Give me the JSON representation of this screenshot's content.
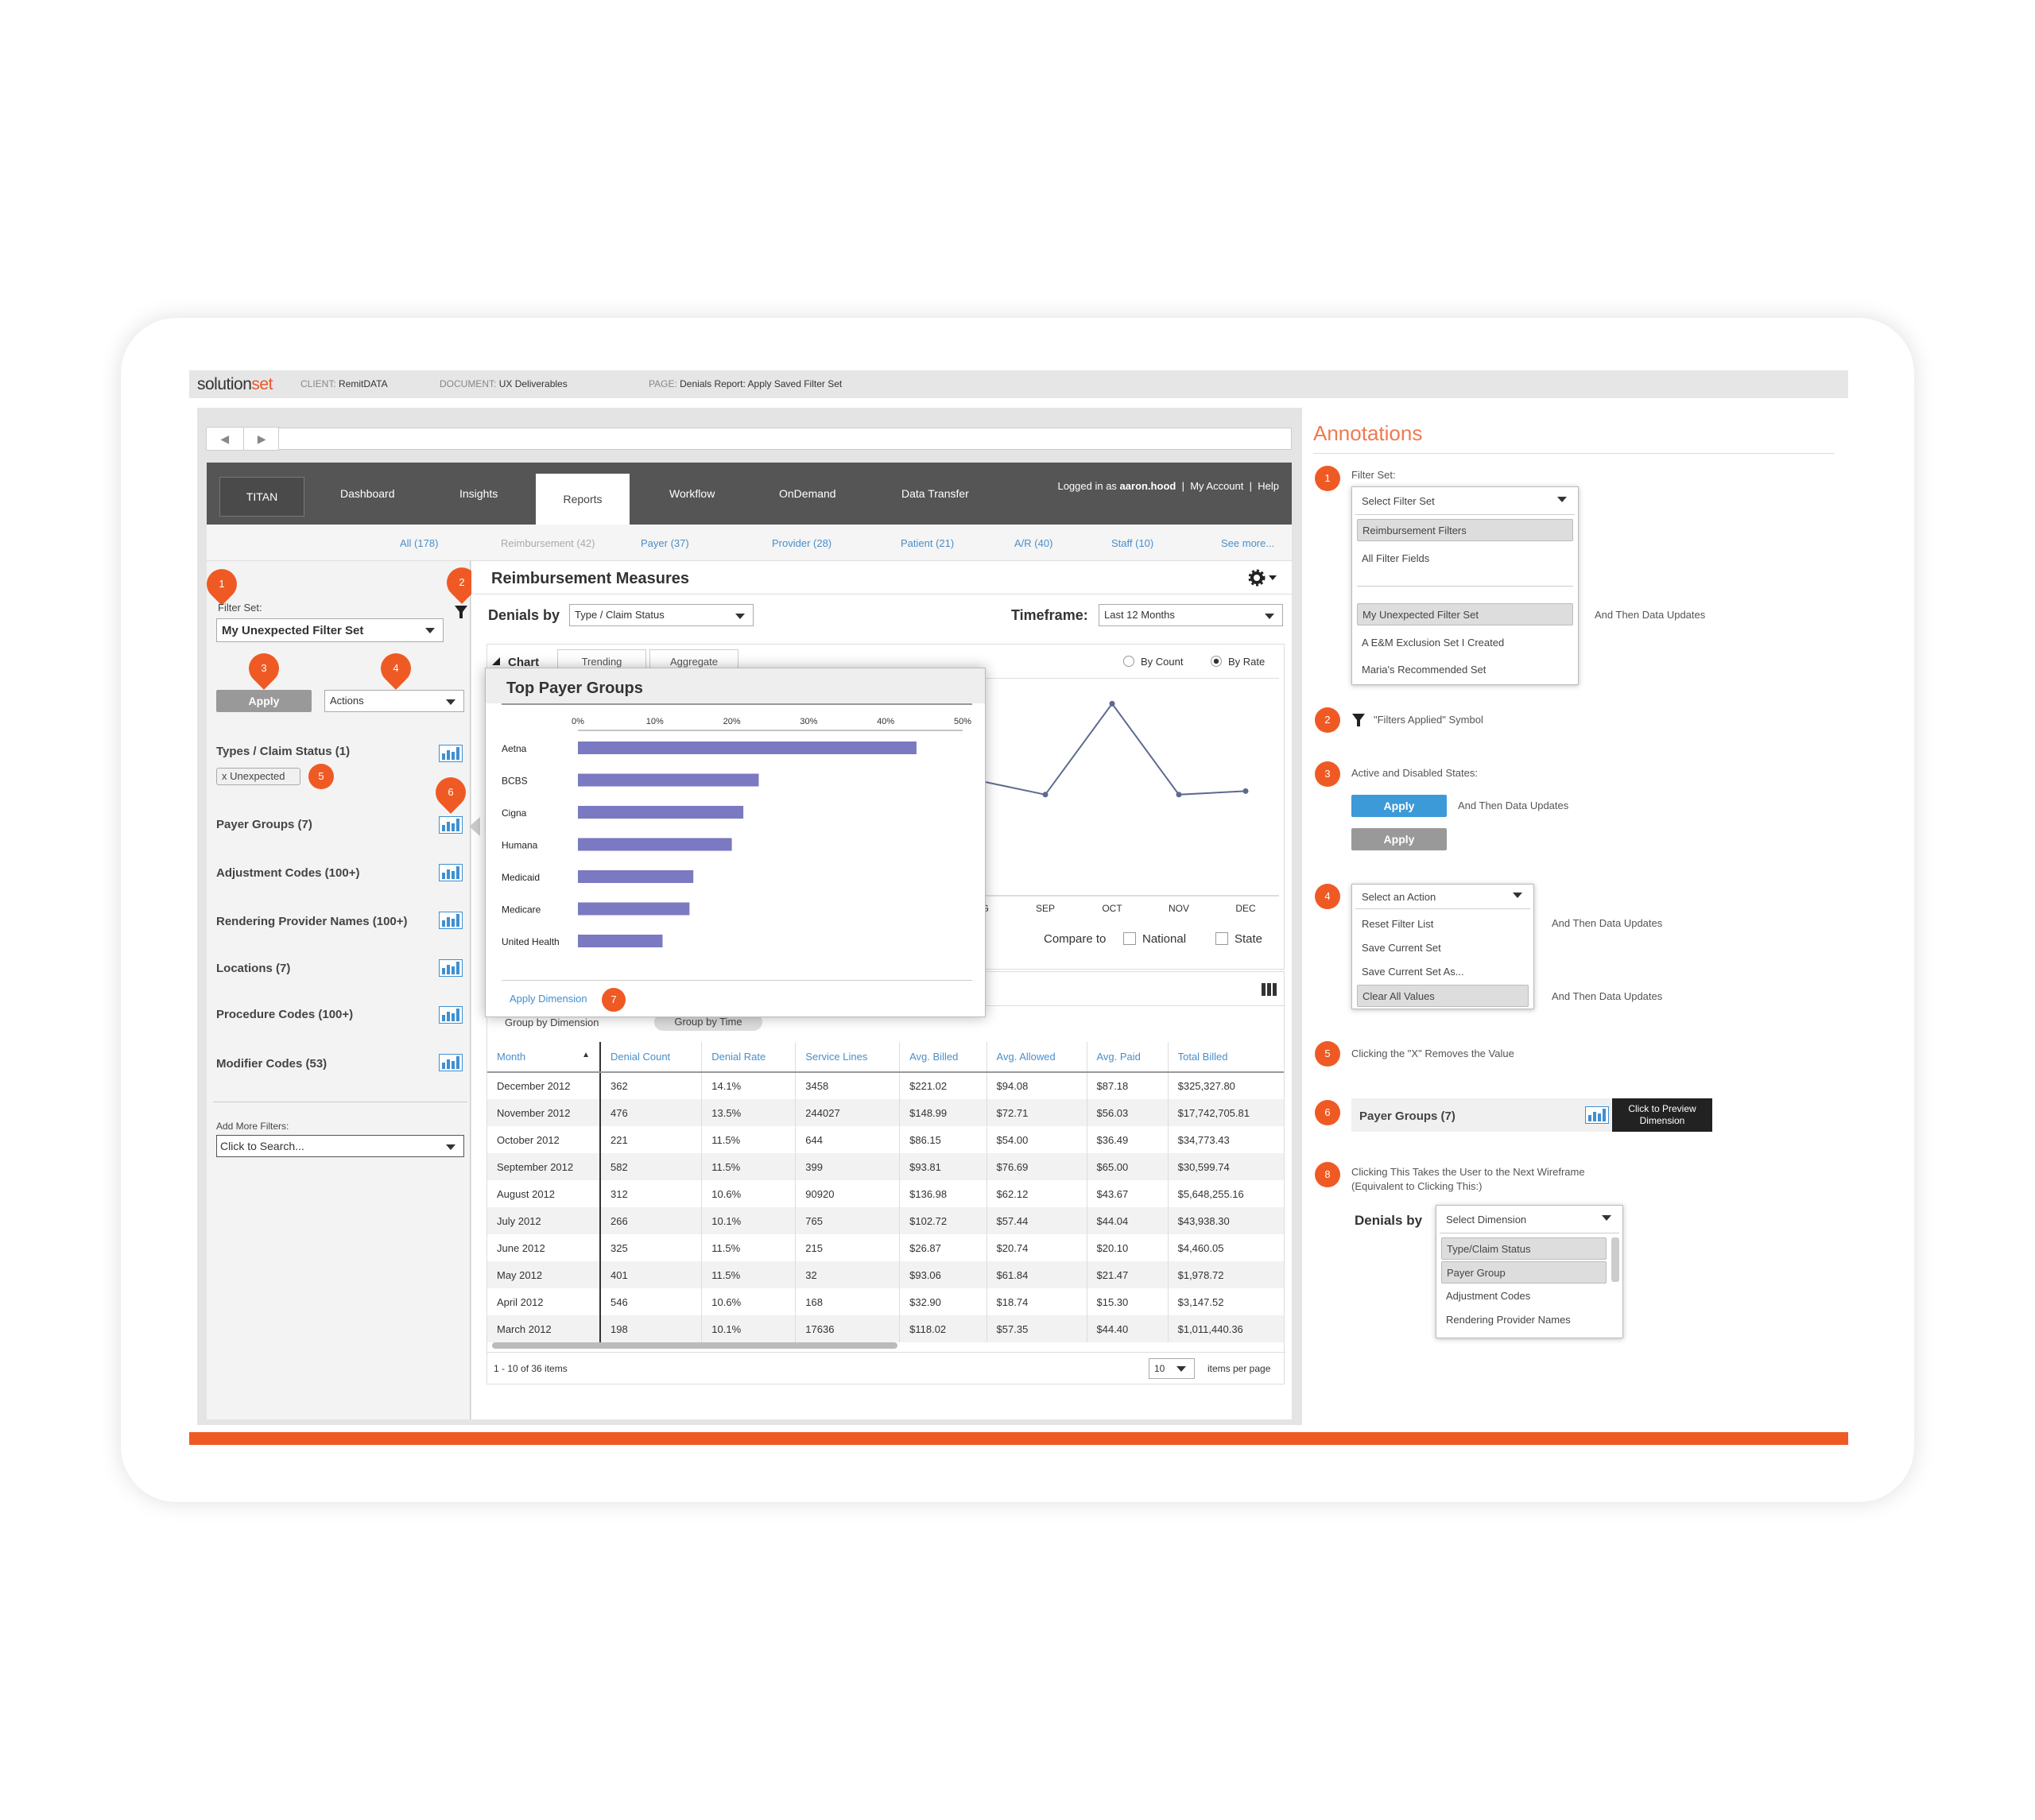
{
  "docbar": {
    "logo_pre": "solution",
    "logo_post": "set",
    "client_label": "CLIENT:",
    "client_value": "RemitDATA",
    "document_label": "DOCUMENT:",
    "document_value": "UX Deliverables",
    "page_label": "PAGE:",
    "page_value": "Denials Report: Apply Saved Filter Set"
  },
  "browser": {
    "back": "◀",
    "forward": "▶"
  },
  "nav": {
    "brand": "TITAN",
    "tabs": [
      "Dashboard",
      "Insights",
      "Reports",
      "Workflow",
      "OnDemand",
      "Data Transfer"
    ],
    "logged_in_prefix": "Logged in as",
    "username": "aaron.hood",
    "sep1": "|",
    "my_account": "My Account",
    "sep2": "|",
    "help": "Help"
  },
  "subnav": [
    "All (178)",
    "Reimbursement (42)",
    "Payer (37)",
    "Provider (28)",
    "Patient (21)",
    "A/R (40)",
    "Staff (10)",
    "See more..."
  ],
  "sidebar": {
    "filter_set_label": "Filter Set:",
    "filter_set_value": "My Unexpected Filter Set",
    "apply": "Apply",
    "actions": "Actions",
    "filters": [
      "Types / Claim Status (1)",
      "Payer Groups (7)",
      "Adjustment Codes (100+)",
      "Rendering Provider Names (100+)",
      "Locations (7)",
      "Procedure Codes (100+)",
      "Modifier Codes (53)"
    ],
    "chip": "x  Unexpected",
    "add_more_label": "Add More Filters:",
    "search_placeholder": "Click to Search..."
  },
  "badges": {
    "b1": "1",
    "b2": "2",
    "b3": "3",
    "b4": "4",
    "b5": "5",
    "b6": "6",
    "b7": "7"
  },
  "main": {
    "title": "Reimbursement Measures",
    "denials_by_label": "Denials by",
    "denials_by_value": "Type / Claim Status",
    "timeframe_label": "Timeframe:",
    "timeframe_value": "Last 12 Months",
    "chart_tab": "Chart",
    "trending_tab": "Trending",
    "aggregate_tab": "Aggregate",
    "by_count": "By Count",
    "by_rate": "By Rate",
    "compare_to": "Compare to",
    "national": "National",
    "state": "State",
    "group_by_dimension": "Group by Dimension",
    "group_by_time": "Group by Time"
  },
  "popup": {
    "title": "Top Payer Groups",
    "apply_dimension": "Apply Dimension"
  },
  "chart_data": [
    {
      "type": "bar",
      "title": "Top Payer Groups",
      "categories": [
        "Aetna",
        "BCBS",
        "Cigna",
        "Humana",
        "Medicaid",
        "Medicare",
        "United Health"
      ],
      "values": [
        44,
        23.5,
        21.5,
        20,
        15,
        14.5,
        11
      ],
      "xticks": [
        "0%",
        "10%",
        "20%",
        "30%",
        "40%",
        "50%"
      ],
      "xlim": [
        0,
        50
      ],
      "color": "#7a79c2"
    },
    {
      "type": "line",
      "categories": [
        "AUG",
        "SEP",
        "OCT",
        "NOV",
        "DEC"
      ],
      "values": [
        1.2,
        0.8,
        3.4,
        0.8,
        0.9
      ],
      "color": "#5d6a8f"
    }
  ],
  "table": {
    "columns": [
      "Month",
      "Denial Count",
      "Denial Rate",
      "Service Lines",
      "Avg. Billed",
      "Avg. Allowed",
      "Avg. Paid",
      "Total Billed"
    ],
    "rows": [
      [
        "December 2012",
        "362",
        "14.1%",
        "3458",
        "$221.02",
        "$94.08",
        "$87.18",
        "$325,327.80"
      ],
      [
        "November 2012",
        "476",
        "13.5%",
        "244027",
        "$148.99",
        "$72.71",
        "$56.03",
        "$17,742,705.81"
      ],
      [
        "October 2012",
        "221",
        "11.5%",
        "644",
        "$86.15",
        "$54.00",
        "$36.49",
        "$34,773.43"
      ],
      [
        "September 2012",
        "582",
        "11.5%",
        "399",
        "$93.81",
        "$76.69",
        "$65.00",
        "$30,599.74"
      ],
      [
        "August 2012",
        "312",
        "10.6%",
        "90920",
        "$136.98",
        "$62.12",
        "$43.67",
        "$5,648,255.16"
      ],
      [
        "July 2012",
        "266",
        "10.1%",
        "765",
        "$102.72",
        "$57.44",
        "$44.04",
        "$43,938.30"
      ],
      [
        "June 2012",
        "325",
        "11.5%",
        "215",
        "$26.87",
        "$20.74",
        "$20.10",
        "$4,460.05"
      ],
      [
        "May 2012",
        "401",
        "11.5%",
        "32",
        "$93.06",
        "$61.84",
        "$21.47",
        "$1,978.72"
      ],
      [
        "April 2012",
        "546",
        "10.6%",
        "168",
        "$32.90",
        "$18.74",
        "$15.30",
        "$3,147.52"
      ],
      [
        "March 2012",
        "198",
        "10.1%",
        "17636",
        "$118.02",
        "$57.35",
        "$44.40",
        "$1,011,440.36"
      ]
    ],
    "footer": "1 - 10 of 36 items",
    "per_page": "10",
    "per_page_label": "items per page"
  },
  "annotations": {
    "title": "Annotations",
    "n1_label": "Filter Set:",
    "n1_options": [
      "Select Filter Set",
      "Reimbursement Filters",
      "All Filter Fields",
      "My Unexpected Filter Set",
      "A E&M Exclusion Set I Created",
      "Maria's Recommended Set"
    ],
    "n1_note": "And Then Data Updates",
    "n2_text": "\"Filters Applied\" Symbol",
    "n3_text": "Active and Disabled States:",
    "n3_apply": "Apply",
    "n3_note": "And Then Data Updates",
    "n4_options": [
      "Select an Action",
      "Reset Filter List",
      "Save Current Set",
      "Save Current Set As...",
      "Clear All Values"
    ],
    "n4_note1": "And Then Data Updates",
    "n4_note2": "And Then Data Updates",
    "n5_text": "Clicking the \"X\" Removes the Value",
    "n6_label": "Payer Groups (7)",
    "n6_tooltip_1": "Click to Preview",
    "n6_tooltip_2": "Dimension",
    "n8_text_1": "Clicking This Takes the User to the Next Wireframe",
    "n8_text_2": "(Equivalent to Clicking This:)",
    "n8_denials_by": "Denials by",
    "n8_options": [
      "Select Dimension",
      "Type/Claim Status",
      "Payer Group",
      "Adjustment Codes",
      "Rendering Provider Names"
    ],
    "nums": [
      "1",
      "2",
      "3",
      "4",
      "5",
      "6",
      "8"
    ]
  },
  "colors": {
    "accent": "#ef5a24",
    "nav": "#555555",
    "link": "#4a8ec9",
    "apply_active": "#3d9ad8",
    "apply_disabled": "#999999"
  }
}
